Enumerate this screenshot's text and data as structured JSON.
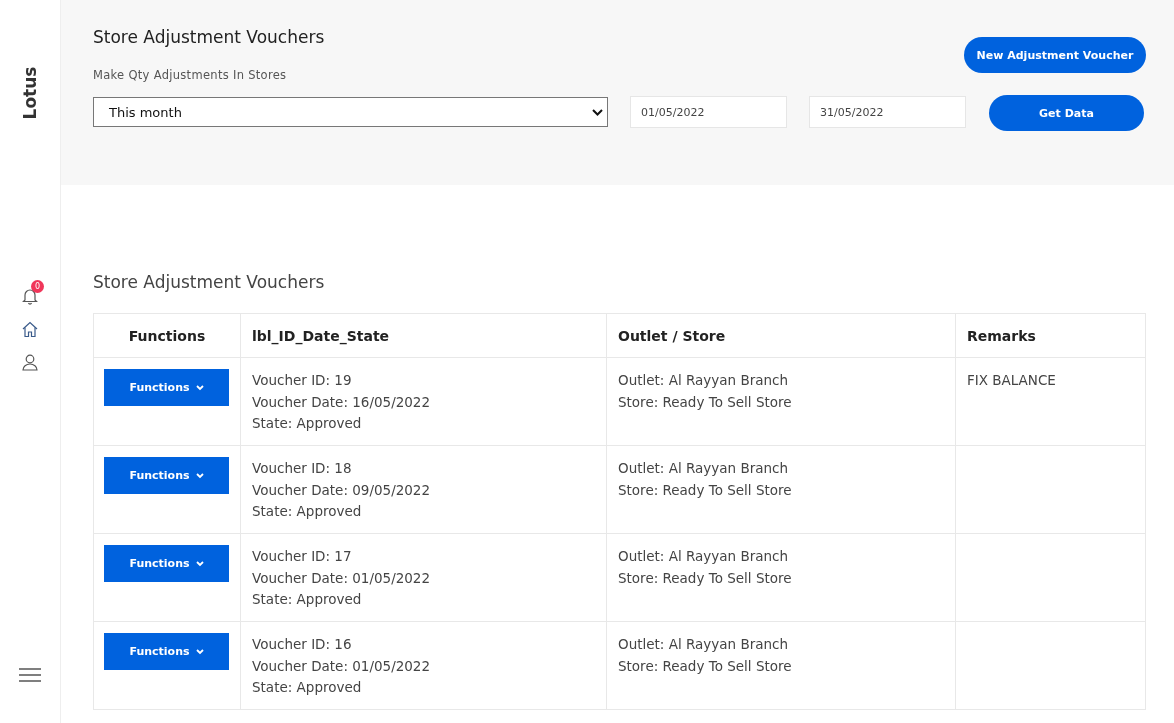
{
  "sidebar": {
    "brand": "Lotus",
    "notification_count": "0"
  },
  "header": {
    "title": "Store Adjustment Vouchers",
    "subtitle": "Make Qty Adjustments In Stores",
    "period": "This month",
    "date_from": "01/05/2022",
    "date_to": "31/05/2022",
    "new_button": "New Adjustment Voucher",
    "get_button": "Get Data"
  },
  "section_title": "Store Adjustment Vouchers",
  "table": {
    "columns": [
      "Functions",
      "lbl_ID_Date_State",
      "Outlet / Store",
      "Remarks"
    ],
    "rows": [
      {
        "button": "Functions",
        "voucher_id": "Voucher ID: 19",
        "voucher_date": "Voucher Date: 16/05/2022",
        "state": "State: Approved",
        "outlet": "Outlet: Al Rayyan Branch",
        "store": "Store: Ready To Sell Store",
        "remarks": "FIX BALANCE"
      },
      {
        "button": "Functions",
        "voucher_id": "Voucher ID: 18",
        "voucher_date": "Voucher Date: 09/05/2022",
        "state": "State: Approved",
        "outlet": "Outlet: Al Rayyan Branch",
        "store": "Store: Ready To Sell Store"
      },
      {
        "button": "Functions",
        "voucher_id": "Voucher ID: 17",
        "voucher_date": "Voucher Date: 01/05/2022",
        "state": "State: Approved",
        "outlet": "Outlet: Al Rayyan Branch",
        "store": "Store: Ready To Sell Store"
      },
      {
        "button": "Functions",
        "voucher_id": "Voucher ID: 16",
        "voucher_date": "Voucher Date: 01/05/2022",
        "state": "State: Approved",
        "outlet": "Outlet: Al Rayyan Branch",
        "store": "Store: Ready To Sell Store"
      }
    ]
  }
}
